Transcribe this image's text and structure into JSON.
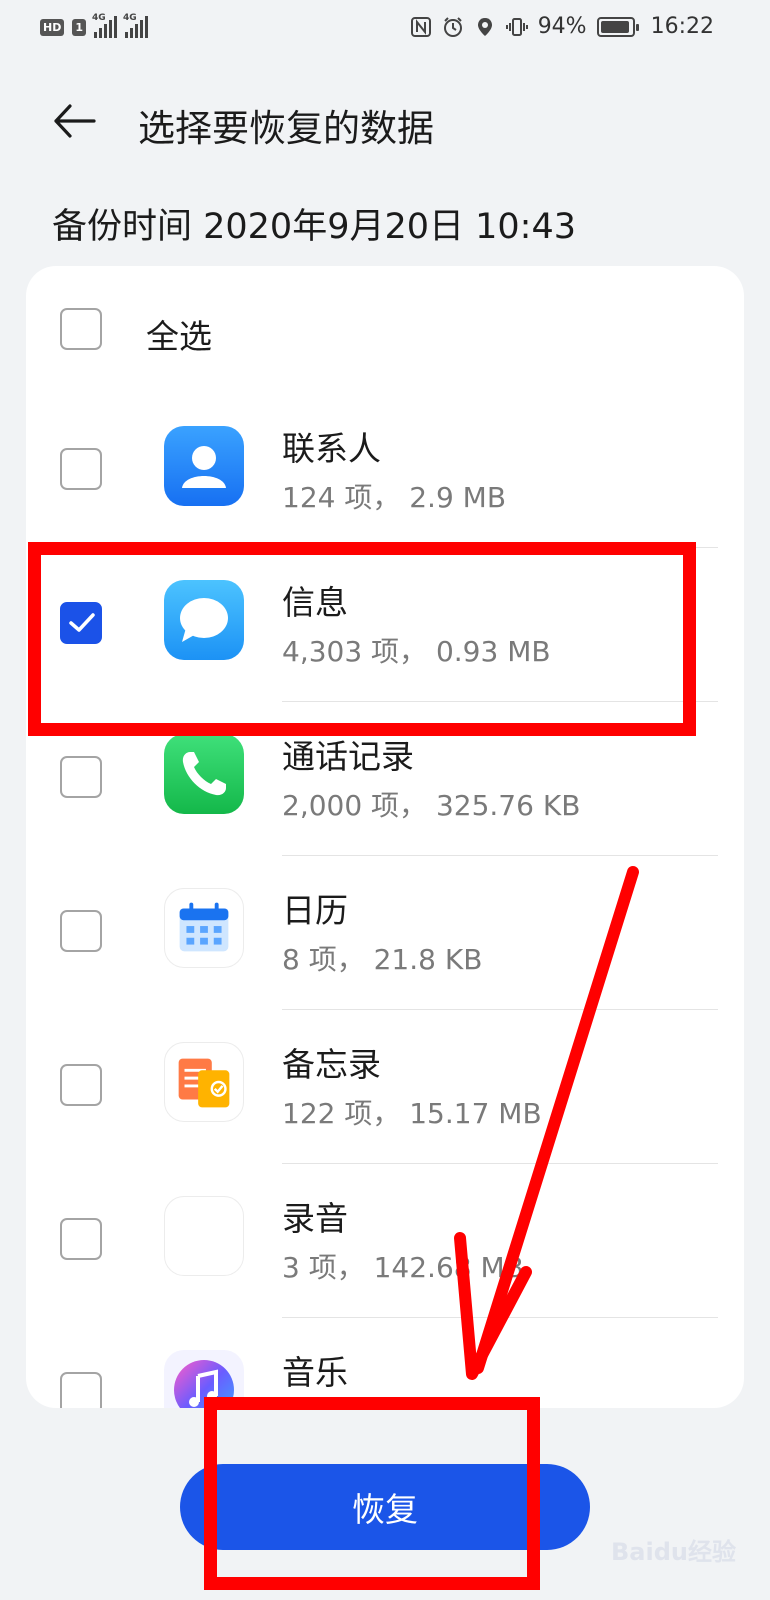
{
  "status_bar": {
    "hd": "HD",
    "sim_1": "1",
    "net_1": "4G",
    "net_2": "4G",
    "battery_pct": "94%",
    "battery_level": 0.94,
    "time": "16:22"
  },
  "header": {
    "back_icon": "arrow-left-icon",
    "title": "选择要恢复的数据"
  },
  "backup_time": "备份时间 2020年9月20日 10:43",
  "select_all": {
    "label": "全选",
    "checked": false
  },
  "items": [
    {
      "name": "联系人",
      "info": "124 项， 2.9 MB",
      "checked": false,
      "icon": "contacts-icon"
    },
    {
      "name": "信息",
      "info": "4,303 项， 0.93 MB",
      "checked": true,
      "icon": "messages-icon"
    },
    {
      "name": "通话记录",
      "info": "2,000 项， 325.76 KB",
      "checked": false,
      "icon": "phone-icon"
    },
    {
      "name": "日历",
      "info": "8 项， 21.8 KB",
      "checked": false,
      "icon": "calendar-icon"
    },
    {
      "name": "备忘录",
      "info": "122 项， 15.17 MB",
      "checked": false,
      "icon": "notes-icon"
    },
    {
      "name": "录音",
      "info": "3 项， 142.68 MB",
      "checked": false,
      "icon": "recorder-icon"
    },
    {
      "name": "音乐",
      "info": "",
      "checked": false,
      "icon": "music-icon"
    }
  ],
  "restore_button": {
    "label": "恢复"
  },
  "colors": {
    "accent": "#1b55e8",
    "annotation": "#ff0000",
    "background": "#f1f3f5"
  },
  "watermark": "Baidu经验"
}
